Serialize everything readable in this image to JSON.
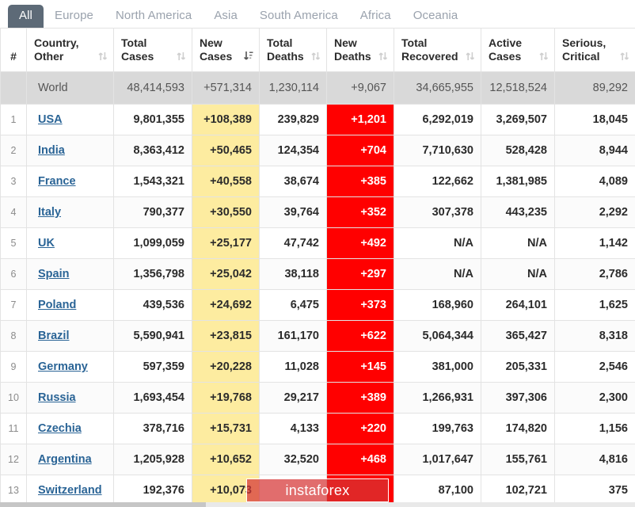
{
  "tabs": [
    {
      "label": "All",
      "active": true
    },
    {
      "label": "Europe",
      "active": false
    },
    {
      "label": "North America",
      "active": false
    },
    {
      "label": "Asia",
      "active": false
    },
    {
      "label": "South America",
      "active": false
    },
    {
      "label": "Africa",
      "active": false
    },
    {
      "label": "Oceania",
      "active": false
    }
  ],
  "columns": [
    {
      "key": "rank",
      "line1": "#",
      "line2": "",
      "sort": "none"
    },
    {
      "key": "name",
      "line1": "Country,",
      "line2": "Other",
      "sort": "both"
    },
    {
      "key": "total_cases",
      "line1": "Total",
      "line2": "Cases",
      "sort": "both"
    },
    {
      "key": "new_cases",
      "line1": "New",
      "line2": "Cases",
      "sort": "desc"
    },
    {
      "key": "total_deaths",
      "line1": "Total",
      "line2": "Deaths",
      "sort": "both"
    },
    {
      "key": "new_deaths",
      "line1": "New",
      "line2": "Deaths",
      "sort": "both"
    },
    {
      "key": "total_recovered",
      "line1": "Total",
      "line2": "Recovered",
      "sort": "both"
    },
    {
      "key": "active_cases",
      "line1": "Active",
      "line2": "Cases",
      "sort": "both"
    },
    {
      "key": "serious_critical",
      "line1": "Serious,",
      "line2": "Critical",
      "sort": "both"
    }
  ],
  "world": {
    "rank": "",
    "name": "World",
    "total_cases": "48,414,593",
    "new_cases": "+571,314",
    "total_deaths": "1,230,114",
    "new_deaths": "+9,067",
    "total_recovered": "34,665,955",
    "active_cases": "12,518,524",
    "serious_critical": "89,292"
  },
  "rows": [
    {
      "rank": "1",
      "name": "USA",
      "total_cases": "9,801,355",
      "new_cases": "+108,389",
      "total_deaths": "239,829",
      "new_deaths": "+1,201",
      "total_recovered": "6,292,019",
      "active_cases": "3,269,507",
      "serious_critical": "18,045"
    },
    {
      "rank": "2",
      "name": "India",
      "total_cases": "8,363,412",
      "new_cases": "+50,465",
      "total_deaths": "124,354",
      "new_deaths": "+704",
      "total_recovered": "7,710,630",
      "active_cases": "528,428",
      "serious_critical": "8,944"
    },
    {
      "rank": "3",
      "name": "France",
      "total_cases": "1,543,321",
      "new_cases": "+40,558",
      "total_deaths": "38,674",
      "new_deaths": "+385",
      "total_recovered": "122,662",
      "active_cases": "1,381,985",
      "serious_critical": "4,089"
    },
    {
      "rank": "4",
      "name": "Italy",
      "total_cases": "790,377",
      "new_cases": "+30,550",
      "total_deaths": "39,764",
      "new_deaths": "+352",
      "total_recovered": "307,378",
      "active_cases": "443,235",
      "serious_critical": "2,292"
    },
    {
      "rank": "5",
      "name": "UK",
      "total_cases": "1,099,059",
      "new_cases": "+25,177",
      "total_deaths": "47,742",
      "new_deaths": "+492",
      "total_recovered": "N/A",
      "active_cases": "N/A",
      "serious_critical": "1,142"
    },
    {
      "rank": "6",
      "name": "Spain",
      "total_cases": "1,356,798",
      "new_cases": "+25,042",
      "total_deaths": "38,118",
      "new_deaths": "+297",
      "total_recovered": "N/A",
      "active_cases": "N/A",
      "serious_critical": "2,786"
    },
    {
      "rank": "7",
      "name": "Poland",
      "total_cases": "439,536",
      "new_cases": "+24,692",
      "total_deaths": "6,475",
      "new_deaths": "+373",
      "total_recovered": "168,960",
      "active_cases": "264,101",
      "serious_critical": "1,625"
    },
    {
      "rank": "8",
      "name": "Brazil",
      "total_cases": "5,590,941",
      "new_cases": "+23,815",
      "total_deaths": "161,170",
      "new_deaths": "+622",
      "total_recovered": "5,064,344",
      "active_cases": "365,427",
      "serious_critical": "8,318"
    },
    {
      "rank": "9",
      "name": "Germany",
      "total_cases": "597,359",
      "new_cases": "+20,228",
      "total_deaths": "11,028",
      "new_deaths": "+145",
      "total_recovered": "381,000",
      "active_cases": "205,331",
      "serious_critical": "2,546"
    },
    {
      "rank": "10",
      "name": "Russia",
      "total_cases": "1,693,454",
      "new_cases": "+19,768",
      "total_deaths": "29,217",
      "new_deaths": "+389",
      "total_recovered": "1,266,931",
      "active_cases": "397,306",
      "serious_critical": "2,300"
    },
    {
      "rank": "11",
      "name": "Czechia",
      "total_cases": "378,716",
      "new_cases": "+15,731",
      "total_deaths": "4,133",
      "new_deaths": "+220",
      "total_recovered": "199,763",
      "active_cases": "174,820",
      "serious_critical": "1,156"
    },
    {
      "rank": "12",
      "name": "Argentina",
      "total_cases": "1,205,928",
      "new_cases": "+10,652",
      "total_deaths": "32,520",
      "new_deaths": "+468",
      "total_recovered": "1,017,647",
      "active_cases": "155,761",
      "serious_critical": "4,816"
    },
    {
      "rank": "13",
      "name": "Switzerland",
      "total_cases": "192,376",
      "new_cases": "+10,073",
      "total_deaths": "",
      "new_deaths": "",
      "total_recovered": "87,100",
      "active_cases": "102,721",
      "serious_critical": "375"
    }
  ],
  "watermark": {
    "text": "instaforex"
  },
  "colors": {
    "tab_active_bg": "#5d6a77",
    "tab_text": "#9aa2ad",
    "new_cases_highlight": "#fdeca0",
    "new_deaths_highlight": "#ff0000",
    "world_row_bg": "#d9d9d9",
    "link": "#2a6496",
    "watermark_bg": "#d63434"
  }
}
